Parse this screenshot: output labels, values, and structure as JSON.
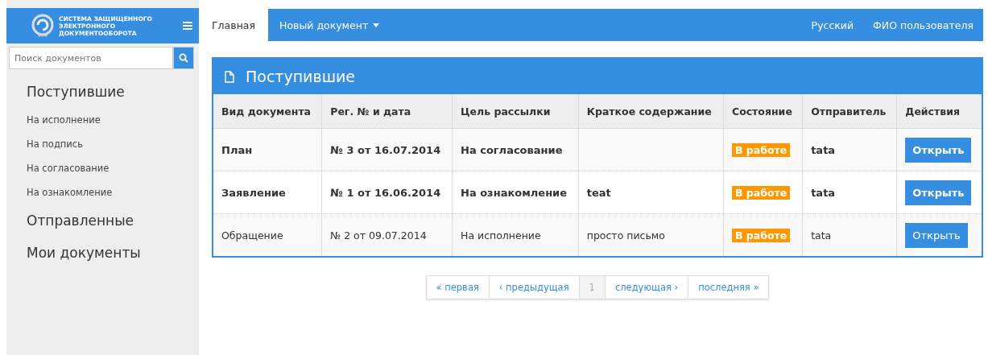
{
  "logo": {
    "lines": [
      "СИСТЕМА ЗАЩИЩЕННОГО",
      "ЭЛЕКТРОННОГО",
      "ДОКУМЕНТООБОРОТА"
    ]
  },
  "search": {
    "placeholder": "Поиск документов"
  },
  "sidebar": {
    "items": [
      {
        "label": "Поступившие",
        "children": [
          {
            "label": "На исполнение"
          },
          {
            "label": "На подпись"
          },
          {
            "label": "На согласование"
          },
          {
            "label": "На ознакомление"
          }
        ]
      },
      {
        "label": "Отправленные"
      },
      {
        "label": "Мои документы"
      }
    ]
  },
  "nav": {
    "tabs": [
      {
        "label": "Главная",
        "selected": true
      },
      {
        "label": "Новый документ",
        "selected": false,
        "dropdown": true
      }
    ],
    "right": [
      "Русский",
      "ФИО пользователя"
    ]
  },
  "panel": {
    "title": "Поступившие"
  },
  "table": {
    "columns": [
      "Вид документа",
      "Рег. № и дата",
      "Цель рассылки",
      "Краткое содержание",
      "Состояние",
      "Отправитель",
      "Действия"
    ],
    "rows": [
      {
        "unread": true,
        "cells": [
          "План",
          "№ 3 от 16.07.2014",
          "На согласование",
          ""
        ],
        "status": "В работе",
        "sender": "tata",
        "action": "Открыть"
      },
      {
        "unread": true,
        "cells": [
          "Заявление",
          "№ 1 от 16.06.2014",
          "На ознакомление",
          "teat"
        ],
        "status": "В работе",
        "sender": "tata",
        "action": "Открыть"
      },
      {
        "unread": false,
        "cells": [
          "Обращение",
          "№ 2 от 09.07.2014",
          "На исполнение",
          "просто письмо"
        ],
        "status": "В работе",
        "sender": "tata",
        "action": "Открыть"
      }
    ]
  },
  "pagination": [
    {
      "label": "« первая",
      "selected": false
    },
    {
      "label": "‹ предыдущая",
      "selected": false
    },
    {
      "label": "1",
      "selected": true
    },
    {
      "label": "следующая ›",
      "selected": false
    },
    {
      "label": "последняя »",
      "selected": false
    }
  ]
}
